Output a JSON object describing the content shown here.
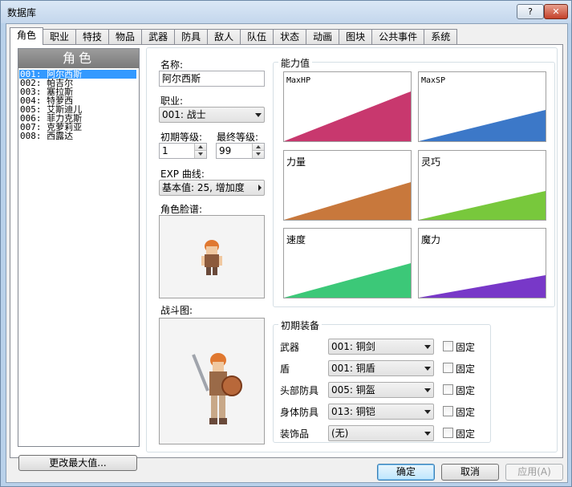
{
  "window": {
    "title": "数据库",
    "help_label": "?",
    "close_label": "✕"
  },
  "tabs": [
    {
      "label": "角色",
      "active": true
    },
    {
      "label": "职业"
    },
    {
      "label": "特技"
    },
    {
      "label": "物品"
    },
    {
      "label": "武器"
    },
    {
      "label": "防具"
    },
    {
      "label": "敌人"
    },
    {
      "label": "队伍"
    },
    {
      "label": "状态"
    },
    {
      "label": "动画"
    },
    {
      "label": "图块"
    },
    {
      "label": "公共事件"
    },
    {
      "label": "系统"
    }
  ],
  "actor_list": {
    "header": "角色",
    "items": [
      "001: 阿尔西斯",
      "002: 帕吉尔",
      "003: 塞拉斯",
      "004: 特萝西",
      "005: 艾斯迪儿",
      "006: 菲力克斯",
      "007: 克萝莉亚",
      "008: 西露达"
    ],
    "selected_index": 0,
    "change_max_button": "更改最大值..."
  },
  "actor": {
    "name_label": "名称:",
    "name_value": "阿尔西斯",
    "class_label": "职业:",
    "class_value": "001: 战士",
    "initial_level_label": "初期等级:",
    "initial_level_value": "1",
    "final_level_label": "最终等级:",
    "final_level_value": "99",
    "exp_curve_label": "EXP 曲线:",
    "exp_curve_value": "基本值: 25, 增加度",
    "face_graphic_label": "角色脸谱:",
    "battler_graphic_label": "战斗图:"
  },
  "parameters": {
    "title": "能力值",
    "items": [
      {
        "label": "MaxHP",
        "mono": true,
        "color": "#c8386e"
      },
      {
        "label": "MaxSP",
        "mono": true,
        "color": "#3c78c8"
      },
      {
        "label": "力量",
        "color": "#c8783c"
      },
      {
        "label": "灵巧",
        "color": "#78c83c"
      },
      {
        "label": "速度",
        "color": "#3cc878"
      },
      {
        "label": "魔力",
        "color": "#7838c8"
      }
    ]
  },
  "equipment": {
    "title": "初期装备",
    "fixed_label": "固定",
    "rows": [
      {
        "label": "武器",
        "value": "001: 铜剑"
      },
      {
        "label": "盾",
        "value": "001: 铜盾"
      },
      {
        "label": "头部防具",
        "value": "005: 铜盔"
      },
      {
        "label": "身体防具",
        "value": "013: 铜铠"
      },
      {
        "label": "装饰品",
        "value": "(无)"
      }
    ]
  },
  "buttons": {
    "ok": "确定",
    "cancel": "取消",
    "apply": "应用(A)"
  }
}
